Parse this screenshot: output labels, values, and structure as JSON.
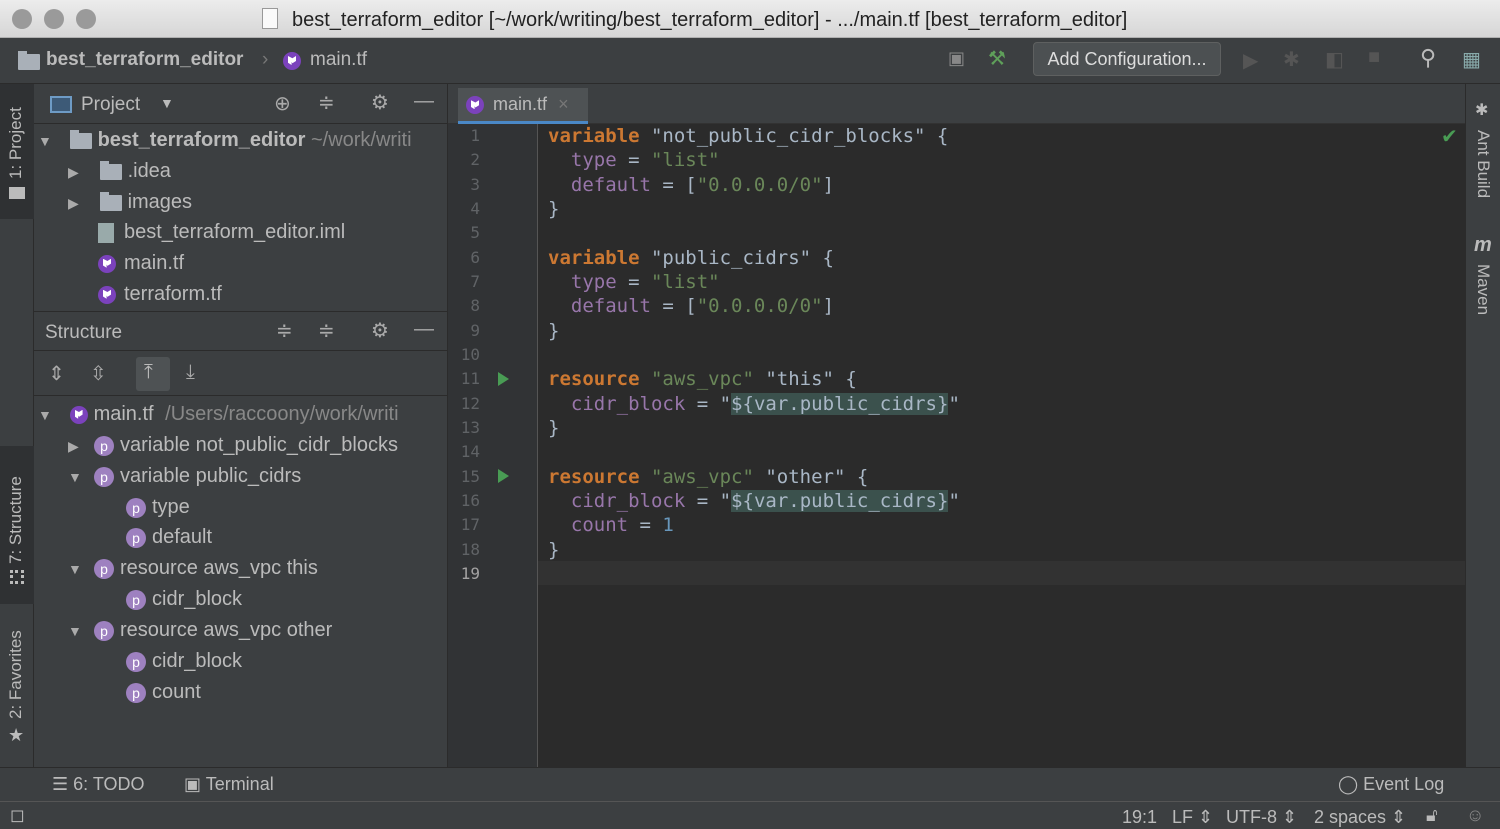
{
  "window": {
    "title": "best_terraform_editor [~/work/writing/best_terraform_editor] - .../main.tf [best_terraform_editor]"
  },
  "navbar": {
    "project": "best_terraform_editor",
    "file": "main.tf",
    "add_config": "Add Configuration..."
  },
  "left_tabs": {
    "project": "1: Project",
    "structure": "7: Structure",
    "favorites": "2: Favorites"
  },
  "right_tabs": {
    "ant": "Ant Build",
    "maven": "Maven",
    "maven_glyph": "m"
  },
  "project_panel": {
    "title": "Project",
    "root_name": "best_terraform_editor",
    "root_path": "~/work/writi",
    "items": [
      ".idea",
      "images",
      "best_terraform_editor.iml",
      "main.tf",
      "terraform.tf"
    ]
  },
  "structure_panel": {
    "title": "Structure",
    "root_name": "main.tf",
    "root_path": "/Users/raccoony/work/writi",
    "nodes": [
      "variable not_public_cidr_blocks",
      "variable public_cidrs",
      "type",
      "default",
      "resource aws_vpc this",
      "cidr_block",
      "resource aws_vpc other",
      "cidr_block",
      "count"
    ],
    "badge": "p"
  },
  "editor": {
    "tab_label": "main.tf",
    "line_numbers": [
      "1",
      "2",
      "3",
      "4",
      "5",
      "6",
      "7",
      "8",
      "9",
      "10",
      "11",
      "12",
      "13",
      "14",
      "15",
      "16",
      "17",
      "18",
      "19"
    ],
    "code": {
      "l1_kw": "variable",
      "l1_name": " \"not_public_cidr_blocks\" {",
      "l2_key": "  type",
      "l2_eq": " = ",
      "l2_val": "\"list\"",
      "l3_key": "  default",
      "l3_eq": " = [",
      "l3_val": "\"0.0.0.0/0\"",
      "l3_end": "]",
      "close": "}",
      "l6_kw": "variable",
      "l6_name": " \"public_cidrs\" {",
      "l11_kw": "resource",
      "l11_type": " \"aws_vpc\"",
      "l11_name": " \"this\" {",
      "l12_key": "  cidr_block",
      "l12_eq": " = \"",
      "l12_pre": "${",
      "l12_var": "var",
      "l12_dot": ".",
      "l12_attr": "public_cidrs",
      "l12_post": "}",
      "l12_q": "\"",
      "l15_kw": "resource",
      "l15_type": " \"aws_vpc\"",
      "l15_name": " \"other\" {",
      "l17_key": "  count",
      "l17_eq": " = ",
      "l17_val": "1"
    }
  },
  "bottom_tools": {
    "todo": "6: TODO",
    "terminal": "Terminal",
    "event_log": "Event Log"
  },
  "status": {
    "position": "19:1",
    "line_sep": "LF ⇕",
    "encoding": "UTF-8 ⇕",
    "indent": "2 spaces ⇕"
  },
  "colors": {
    "keyword": "#cc7832",
    "string": "#6a8759",
    "attribute": "#9876aa",
    "number": "#6897bb",
    "accent": "#4a88c7"
  }
}
